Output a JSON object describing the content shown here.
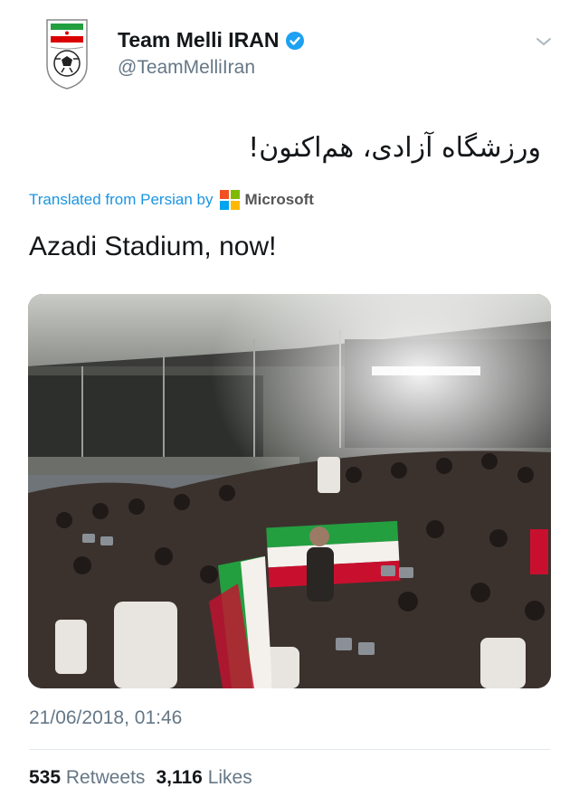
{
  "tweet": {
    "display_name": "Team Melli IRAN",
    "handle": "@TeamMelliIran",
    "original_text": "ورزشگاه آزادی، هم‌اکنون!",
    "translated_from": "Translated from Persian by",
    "translator": "Microsoft",
    "text": "Azadi Stadium, now!",
    "timestamp": "21/06/2018, 01:46",
    "retweets_count": "535",
    "retweets_label": "Retweets",
    "likes_count": "3,116",
    "likes_label": "Likes"
  },
  "icons": {
    "verified": "verified-badge-icon",
    "more": "chevron-down-icon",
    "avatar": "federation-crest-logo"
  },
  "colors": {
    "verified_blue": "#1da1f2",
    "link_blue": "#1b95e0",
    "muted": "#657786"
  }
}
